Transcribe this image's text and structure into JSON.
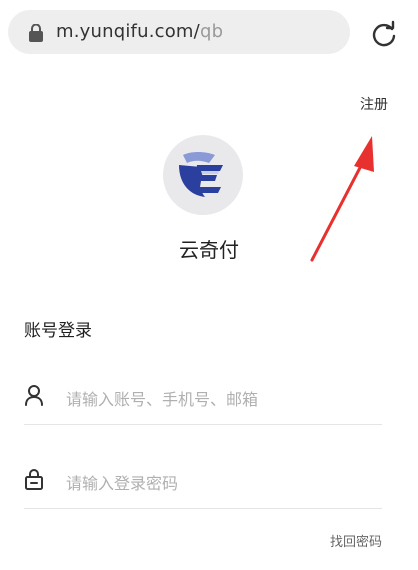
{
  "browser": {
    "url_host": "m.yunqifu.com/",
    "url_path": "qb"
  },
  "header": {
    "register_label": "注册"
  },
  "app": {
    "name": "云奇付"
  },
  "login": {
    "section_title": "账号登录",
    "account_placeholder": "请输入账号、手机号、邮箱",
    "password_placeholder": "请输入登录密码",
    "forgot_password_label": "找回密码"
  },
  "icons": {
    "address_bar": "lock-icon",
    "reload": "reload-icon",
    "account_field": "user-icon",
    "password_field": "lock-icon",
    "annotation": "red-arrow-icon"
  },
  "colors": {
    "annotation_red": "#e8312f",
    "logo_blue": "#2a3f9e",
    "placeholder_gray": "#b0b0b0"
  }
}
